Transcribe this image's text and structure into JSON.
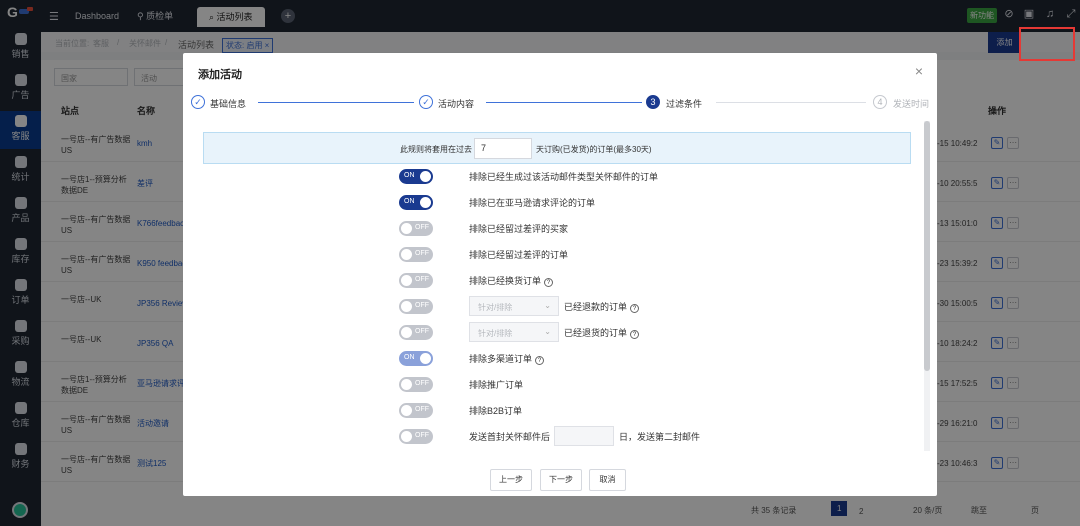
{
  "sidebar": {
    "items": [
      {
        "label": "销售",
        "icon": "sales-icon"
      },
      {
        "label": "广告",
        "icon": "ad-icon"
      },
      {
        "label": "客服",
        "icon": "service-icon",
        "active": true
      },
      {
        "label": "统计",
        "icon": "stats-icon"
      },
      {
        "label": "产品",
        "icon": "product-icon"
      },
      {
        "label": "库存",
        "icon": "inventory-icon"
      },
      {
        "label": "订单",
        "icon": "order-icon"
      },
      {
        "label": "采购",
        "icon": "purchase-icon"
      },
      {
        "label": "物流",
        "icon": "logistics-icon"
      },
      {
        "label": "仓库",
        "icon": "warehouse-icon"
      },
      {
        "label": "财务",
        "icon": "finance-icon"
      }
    ]
  },
  "topbar": {
    "menu_icon": "☰",
    "tabs": [
      {
        "label": "Dashboard"
      },
      {
        "label": "质检单"
      },
      {
        "label": "活动列表"
      }
    ],
    "tab_add": "+",
    "new_feature": "新功能"
  },
  "breadcrumb": {
    "items": [
      "当前位置:",
      "客服",
      "/",
      "关怀邮件",
      "/",
      "活动列表"
    ],
    "status_chip": "状态: 启用 ×"
  },
  "add_button": "添加",
  "table": {
    "filters": [
      "国家",
      "活动"
    ],
    "headers": [
      "站点",
      "名称",
      "操作"
    ],
    "rows": [
      {
        "site": "一号店--有广告数据US",
        "name": "kmh",
        "time": "-15 10:49:2"
      },
      {
        "site": "一号店1--预算分析数据DE",
        "name": "差评",
        "time": "-10 20:55:5"
      },
      {
        "site": "一号店--有广告数据US",
        "name": "K766feedback",
        "time": "-13 15:01:0"
      },
      {
        "site": "一号店--有广告数据US",
        "name": "K950 feedback",
        "time": "-23 15:39:2"
      },
      {
        "site": "一号店--UK",
        "name": "JP356 Review",
        "time": "-30 15:00:5"
      },
      {
        "site": "一号店--UK",
        "name": "JP356 QA",
        "time": "-10 18:24:2"
      },
      {
        "site": "一号店1--预算分析数据DE",
        "name": "亚马逊请求评",
        "time": "-15 17:52:5"
      },
      {
        "site": "一号店--有广告数据US",
        "name": "活动邀请",
        "time": "-29 16:21:0"
      },
      {
        "site": "一号店--有广告数据US",
        "name": "测试125",
        "time": "-23 10:46:3"
      }
    ],
    "pager": {
      "total": "共 35 条记录",
      "pages": [
        "1",
        "2"
      ],
      "page_size": "20 条/页",
      "goto": "跳至",
      "page_unit": "页"
    }
  },
  "modal": {
    "title": "添加活动",
    "close": "×",
    "steps": [
      {
        "num": "✓",
        "label": "基础信息",
        "state": "done"
      },
      {
        "num": "✓",
        "label": "活动内容",
        "state": "done"
      },
      {
        "num": "3",
        "label": "过滤条件",
        "state": "current"
      },
      {
        "num": "4",
        "label": "发送时间",
        "state": "future"
      }
    ],
    "info": {
      "prefix": "此规则将套用在过去",
      "days": "7",
      "suffix": "天订购(已发货)的订单(最多30天)"
    },
    "options": [
      {
        "label": "排除已经生成过该活动邮件类型关怀邮件的订单",
        "on": true,
        "light": false,
        "help": false
      },
      {
        "label": "排除已在亚马逊请求评论的订单",
        "on": true,
        "light": false,
        "help": false
      },
      {
        "label": "排除已经留过差评的买家",
        "on": false,
        "help": false
      },
      {
        "label": "排除已经留过差评的订单",
        "on": false,
        "help": false
      },
      {
        "label": "排除已经换货订单",
        "on": false,
        "help": true
      },
      {
        "label": "已经退款的订单",
        "on": false,
        "help": true,
        "select": "针对/排除"
      },
      {
        "label": "已经退货的订单",
        "on": false,
        "help": true,
        "select": "针对/排除"
      },
      {
        "label": "排除多渠道订单",
        "on": true,
        "light": true,
        "help": true
      },
      {
        "label": "排除推广订单",
        "on": false,
        "help": false
      },
      {
        "label": "排除B2B订单",
        "on": false,
        "help": false
      },
      {
        "label": "发送首封关怀邮件后",
        "on": false,
        "help": false,
        "day_input": true,
        "after": "日，发送第二封邮件"
      }
    ],
    "switch_on_text": "ON",
    "switch_off_text": "OFF",
    "buttons": {
      "prev": "上一步",
      "next": "下一步",
      "cancel": "取消"
    }
  }
}
